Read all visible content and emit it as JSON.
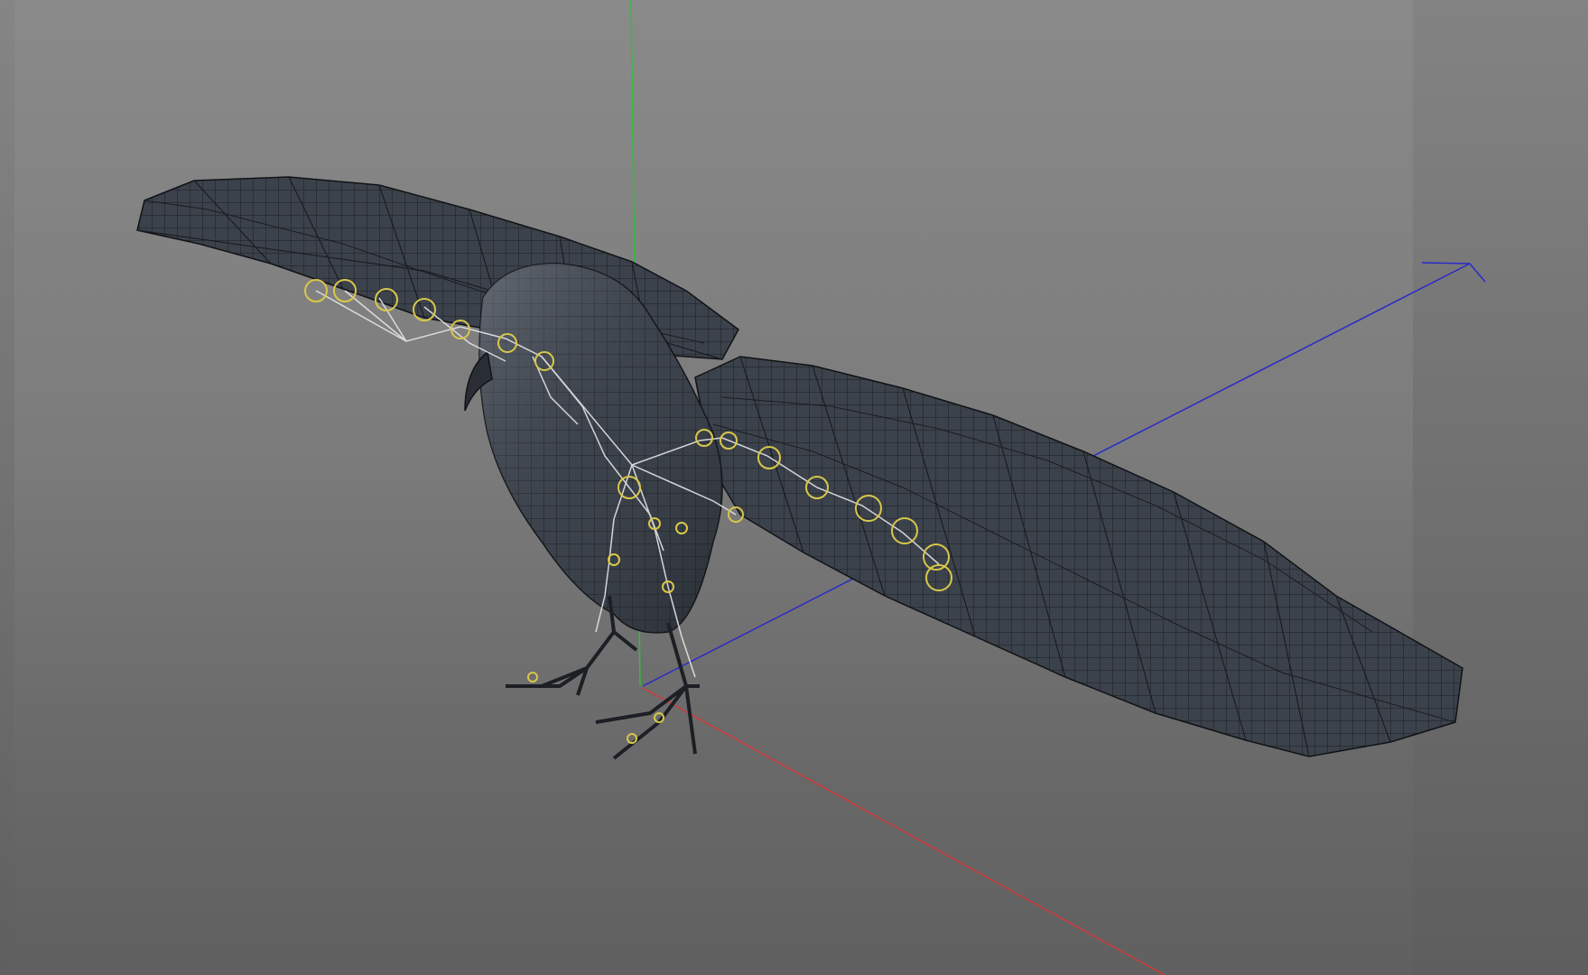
{
  "viewport": {
    "view": "perspective-3d",
    "background_color": "#7a7a7a",
    "grid_visible": false
  },
  "axes": {
    "x_axis_color": "#d23a3a",
    "y_axis_color": "#2fbf3a",
    "z_axis_color": "#2a2ac8"
  },
  "model": {
    "subject": "bird",
    "display_mode": "wireframe-shaded",
    "mesh_color": "#3a3f47",
    "wire_color": "#15181d",
    "rig_bone_color": "#e6e6e6",
    "rig_joint_color": "#d8c74a"
  },
  "icons": {
    "z_axis_arrow": "arrow-head-icon"
  }
}
